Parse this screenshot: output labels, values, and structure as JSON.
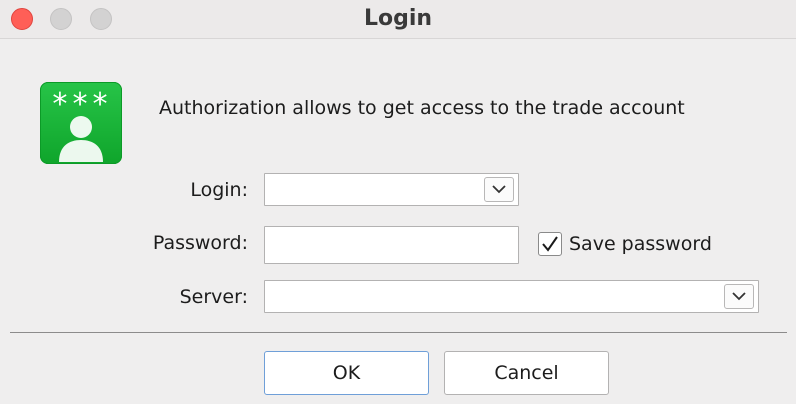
{
  "window": {
    "title": "Login"
  },
  "header": {
    "icon": "password-user-icon",
    "icon_text": "***",
    "description": "Authorization allows to get access to the trade account"
  },
  "form": {
    "login": {
      "label": "Login:",
      "value": "",
      "dropdown_icon": "chevron-down-icon"
    },
    "password": {
      "label": "Password:",
      "value": ""
    },
    "save_password": {
      "label": "Save password",
      "checked": true
    },
    "server": {
      "label": "Server:",
      "value": "",
      "dropdown_icon": "chevron-down-icon"
    }
  },
  "buttons": {
    "ok_label": "OK",
    "cancel_label": "Cancel"
  },
  "colors": {
    "icon_green": "#18b336",
    "close_red": "#ff5f57",
    "default_button_border": "#6f9fd8"
  }
}
